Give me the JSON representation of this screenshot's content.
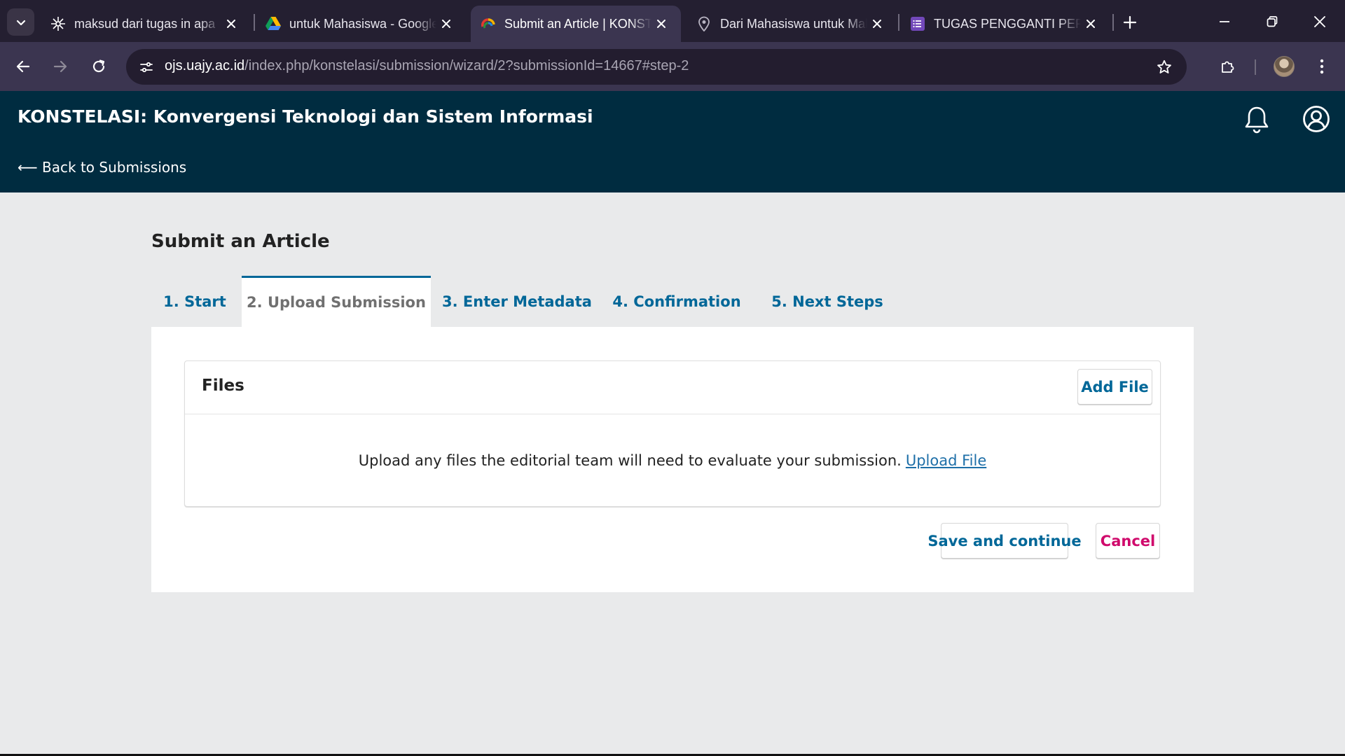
{
  "browser": {
    "tabs": [
      {
        "title": "maksud dari tugas in apa",
        "icon": "pinwheel-favicon-icon",
        "active": false
      },
      {
        "title": "untuk Mahasiswa - Google Drive",
        "icon": "google-drive-icon",
        "active": false
      },
      {
        "title": "Submit an Article | KONSTELASI",
        "icon": "ojs-favicon-icon",
        "active": true
      },
      {
        "title": "Dari Mahasiswa untuk Mahasiswa",
        "icon": "location-pin-icon",
        "active": false
      },
      {
        "title": "TUGAS PENGGANTI PERTEMUAN",
        "icon": "google-forms-icon",
        "active": false
      }
    ],
    "url_host": "ojs.uajy.ac.id",
    "url_path": "/index.php/konstelasi/submission/wizard/2?submissionId=14667#step-2"
  },
  "header": {
    "journal_title": "KONSTELASI: Konvergensi Teknologi dan Sistem Informasi",
    "back_link": "⟵ Back to Submissions"
  },
  "main": {
    "page_title": "Submit an Article",
    "steps": [
      {
        "label": "1. Start",
        "current": false
      },
      {
        "label": "2. Upload Submission",
        "current": true
      },
      {
        "label": "3. Enter Metadata",
        "current": false
      },
      {
        "label": "4. Confirmation",
        "current": false
      },
      {
        "label": "5. Next Steps",
        "current": false
      }
    ],
    "files": {
      "title": "Files",
      "add_file_label": "Add File",
      "empty_text": "Upload any files the editorial team will need to evaluate your submission.",
      "upload_link": "Upload File"
    },
    "save_label": "Save and continue",
    "cancel_label": "Cancel"
  },
  "colors": {
    "header_bg": "#002c40",
    "link_blue": "#006798",
    "cancel_pink": "#d00a6c",
    "page_bg": "#e9eaeb",
    "chrome_tabbar": "#241f31",
    "chrome_toolbar": "#3b3550"
  }
}
